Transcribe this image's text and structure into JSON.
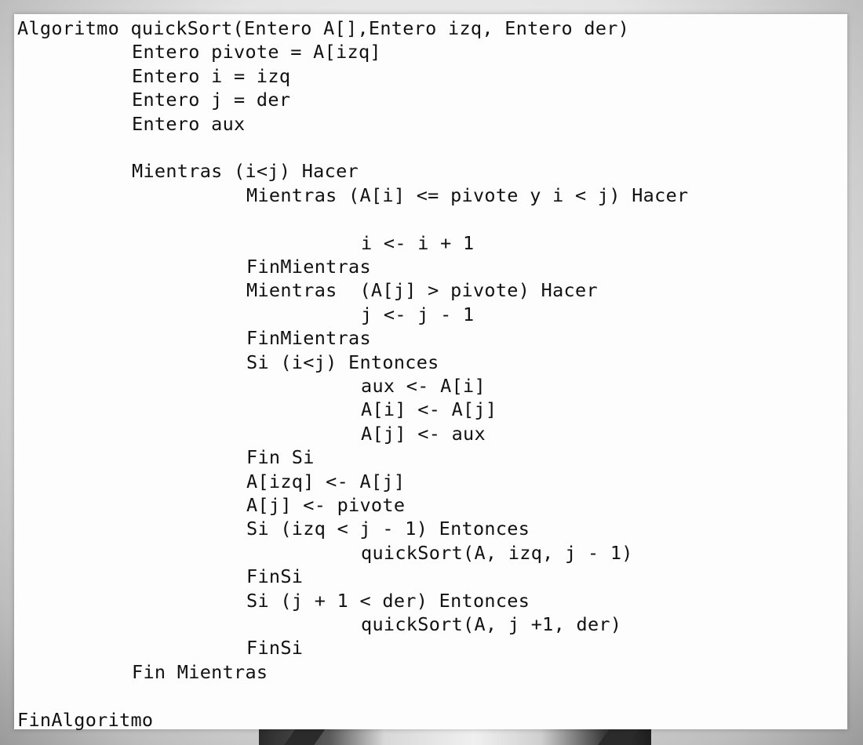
{
  "document": {
    "code_lines": [
      {
        "indent": 0,
        "text": "Algoritmo quickSort(Entero A[],Entero izq, Entero der)"
      },
      {
        "indent": 1,
        "text": "Entero pivote = A[izq]"
      },
      {
        "indent": 1,
        "text": "Entero i = izq"
      },
      {
        "indent": 1,
        "text": "Entero j = der"
      },
      {
        "indent": 1,
        "text": "Entero aux"
      },
      {
        "indent": 0,
        "text": ""
      },
      {
        "indent": 1,
        "text": "Mientras (i<j) Hacer"
      },
      {
        "indent": 2,
        "text": "Mientras (A[i] <= pivote y i < j) Hacer"
      },
      {
        "indent": 0,
        "text": ""
      },
      {
        "indent": 3,
        "text": "i <- i + 1"
      },
      {
        "indent": 2,
        "text": "FinMientras"
      },
      {
        "indent": 2,
        "text": "Mientras  (A[j] > pivote) Hacer"
      },
      {
        "indent": 3,
        "text": "j <- j - 1"
      },
      {
        "indent": 2,
        "text": "FinMientras"
      },
      {
        "indent": 2,
        "text": "Si (i<j) Entonces"
      },
      {
        "indent": 3,
        "text": "aux <- A[i]"
      },
      {
        "indent": 3,
        "text": "A[i] <- A[j]"
      },
      {
        "indent": 3,
        "text": "A[j] <- aux"
      },
      {
        "indent": 2,
        "text": "Fin Si"
      },
      {
        "indent": 2,
        "text": "A[izq] <- A[j]"
      },
      {
        "indent": 2,
        "text": "A[j] <- pivote"
      },
      {
        "indent": 2,
        "text": "Si (izq < j - 1) Entonces"
      },
      {
        "indent": 3,
        "text": "quickSort(A, izq, j - 1)"
      },
      {
        "indent": 2,
        "text": "FinSi"
      },
      {
        "indent": 2,
        "text": "Si (j + 1 < der) Entonces"
      },
      {
        "indent": 3,
        "text": "quickSort(A, j +1, der)"
      },
      {
        "indent": 2,
        "text": "FinSi"
      },
      {
        "indent": 1,
        "text": "Fin Mientras"
      },
      {
        "indent": 0,
        "text": ""
      },
      {
        "indent": 0,
        "text": "FinAlgoritmo"
      }
    ]
  },
  "colors": {
    "text": "#111111",
    "panel": "#fdfdfd"
  }
}
